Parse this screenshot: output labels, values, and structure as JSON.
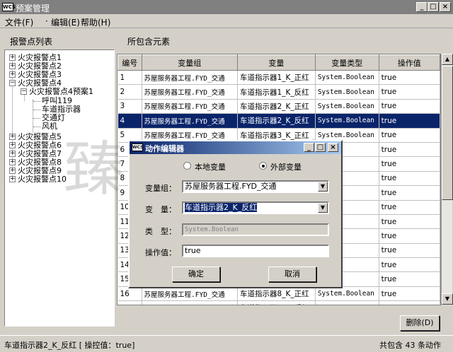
{
  "window": {
    "title": "预案管理",
    "app_icon_text": "WCS"
  },
  "menu": {
    "file": "文件(F)",
    "edit": "编辑(E)",
    "help": "帮助(H)"
  },
  "left_panel": {
    "label": "报警点列表"
  },
  "right_panel": {
    "label": "所包含元素"
  },
  "tree": {
    "items": [
      {
        "label": "火灾报警点1",
        "expander": "+"
      },
      {
        "label": "火灾报警点2",
        "expander": "+"
      },
      {
        "label": "火灾报警点3",
        "expander": "+"
      },
      {
        "label": "火灾报警点4",
        "expander": "−"
      },
      {
        "label": "火灾报警点4预案1",
        "expander": "−"
      },
      {
        "label": "呼叫119"
      },
      {
        "label": "车道指示器"
      },
      {
        "label": "交通灯"
      },
      {
        "label": "风机"
      },
      {
        "label": "火灾报警点5",
        "expander": "+"
      },
      {
        "label": "火灾报警点6",
        "expander": "+"
      },
      {
        "label": "火灾报警点7",
        "expander": "+"
      },
      {
        "label": "火灾报警点8",
        "expander": "+"
      },
      {
        "label": "火灾报警点9",
        "expander": "+"
      },
      {
        "label": "火灾报警点10",
        "expander": "+"
      }
    ]
  },
  "grid": {
    "columns": [
      "编号",
      "变量组",
      "变量",
      "变量类型",
      "操作值"
    ],
    "rows": [
      [
        "1",
        "苏屋服务器工程.FYD_交通",
        "车道指示器1_K_正红",
        "System.Boolean",
        "true"
      ],
      [
        "2",
        "苏屋服务器工程.FYD_交通",
        "车道指示器1_K_反红",
        "System.Boolean",
        "true"
      ],
      [
        "3",
        "苏屋服务器工程.FYD_交通",
        "车道指示器2_K_正红",
        "System.Boolean",
        "true"
      ],
      [
        "4",
        "苏屋服务器工程.FYD_交通",
        "车道指示器2_K_反红",
        "System.Boolean",
        "true"
      ],
      [
        "5",
        "苏屋服务器工程.FYD_交通",
        "车道指示器3_K_正红",
        "System.Boolean",
        "true"
      ],
      [
        "6",
        "",
        "",
        "",
        "true"
      ],
      [
        "7",
        "",
        "",
        "",
        "true"
      ],
      [
        "8",
        "",
        "",
        "",
        "true"
      ],
      [
        "9",
        "",
        "",
        "",
        "true"
      ],
      [
        "10",
        "",
        "",
        "",
        "true"
      ],
      [
        "11",
        "",
        "",
        "",
        "true"
      ],
      [
        "12",
        "",
        "",
        "",
        "true"
      ],
      [
        "13",
        "",
        "",
        "",
        "true"
      ],
      [
        "14",
        "",
        "",
        "",
        "true"
      ],
      [
        "15",
        "",
        "",
        "",
        "true"
      ],
      [
        "16",
        "苏屋服务器工程.FYD_交通",
        "车道指示器8_K_正红",
        "System.Boolean",
        "true"
      ],
      [
        "17",
        "苏屋服务器工程.FYD_交通",
        "车道指示器8_K_反红",
        "",
        ""
      ]
    ],
    "selected_row": 3
  },
  "buttons": {
    "delete": "删除(D)"
  },
  "status": {
    "left": "车道指示器2_K_反红 [ 操控值：true]",
    "right": "共包含 43 条动作"
  },
  "watermark": "臻图信息",
  "dialog": {
    "title": "动作编辑器",
    "radio_local": "本地变量",
    "radio_external": "外部变量",
    "group_label": "变量组：",
    "group_value": "苏屋服务器工程.FYD_交通",
    "var_label": "变　量：",
    "var_value": "车道指示器2_K_反红",
    "type_label": "类　型：",
    "type_value": "System.Boolean",
    "op_label": "操作值：",
    "op_value": "true",
    "ok": "确定",
    "cancel": "取消"
  },
  "colors": {
    "selection": "#0a246a",
    "face": "#d4d0c8",
    "title_inactive": "#808080"
  }
}
